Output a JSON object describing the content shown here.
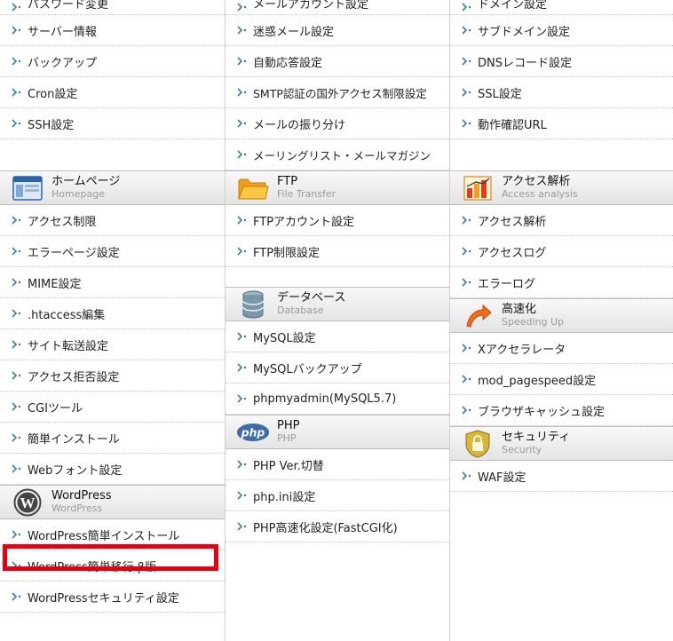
{
  "col1": {
    "partial": "パスワード変更",
    "items_top": [
      "サーバー情報",
      "バックアップ",
      "Cron設定",
      "SSH設定"
    ],
    "homepage": {
      "title": "ホームページ",
      "subtitle": "Homepage",
      "items": [
        "アクセス制限",
        "エラーページ設定",
        "MIME設定",
        ".htaccess編集",
        "サイト転送設定",
        "アクセス拒否設定",
        "CGIツール",
        "簡単インストール",
        "Webフォント設定"
      ]
    },
    "wordpress": {
      "title": "WordPress",
      "subtitle": "WordPress",
      "items": [
        "WordPress簡単インストール",
        "WordPress簡単移行 β版",
        "WordPressセキュリティ設定"
      ]
    }
  },
  "col2": {
    "partial": "メールアカウント設定",
    "items_top": [
      "迷惑メール設定",
      "自動応答設定",
      "SMTP認証の国外アクセス制限設定",
      "メールの振り分け",
      "メーリングリスト・メールマガジン"
    ],
    "ftp": {
      "title": "FTP",
      "subtitle": "File Transfer",
      "items": [
        "FTPアカウント設定",
        "FTP制限設定"
      ]
    },
    "database": {
      "title": "データベース",
      "subtitle": "Database",
      "items": [
        "MySQL設定",
        "MySQLバックアップ",
        "phpmyadmin(MySQL5.7)"
      ]
    },
    "php": {
      "title": "PHP",
      "subtitle": "PHP",
      "icon_text": "php",
      "items": [
        "PHP Ver.切替",
        "php.ini設定",
        "PHP高速化設定(FastCGI化)"
      ]
    }
  },
  "col3": {
    "partial": "ドメイン設定",
    "items_top": [
      "サブドメイン設定",
      "DNSレコード設定",
      "SSL設定",
      "動作確認URL"
    ],
    "access": {
      "title": "アクセス解析",
      "subtitle": "Access analysis",
      "items": [
        "アクセス解析",
        "アクセスログ",
        "エラーログ"
      ]
    },
    "speed": {
      "title": "高速化",
      "subtitle": "Speeding Up",
      "items": [
        "Xアクセラレータ",
        "mod_pagespeed設定",
        "ブラウザキャッシュ設定"
      ]
    },
    "security": {
      "title": "セキュリティ",
      "subtitle": "Security",
      "items": [
        "WAF設定"
      ]
    }
  },
  "colors": {
    "highlight": "#e60012",
    "arrow": "#2f7fb8",
    "header_bg": "#e8e8e8"
  }
}
